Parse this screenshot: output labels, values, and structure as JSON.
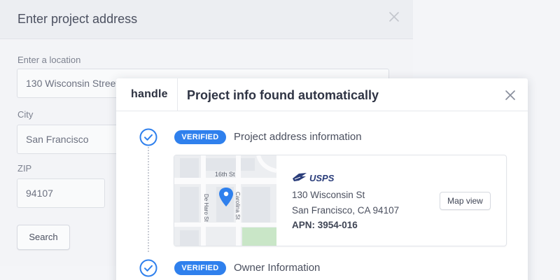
{
  "background_modal": {
    "title": "Enter project address",
    "location_label": "Enter a location",
    "location_value": "130 Wisconsin Street",
    "city_label": "City",
    "city_value": "San Francisco",
    "zip_label": "ZIP",
    "zip_value": "94107",
    "search_label": "Search"
  },
  "project_modal": {
    "logo": "handle",
    "title": "Project info found automatically",
    "steps": [
      {
        "badge": "VERIFIED",
        "title": "Project address information",
        "card": {
          "source": "USPS",
          "address_line1": "130 Wisconsin St",
          "address_line2": "San Francisco, CA 94107",
          "apn": "APN: 3954-016",
          "map_button": "Map view",
          "map_labels": {
            "street_1": "16th St",
            "street_2": "De Haro St",
            "street_3": "Carolina St"
          }
        }
      },
      {
        "badge": "VERIFIED",
        "title": "Owner Information"
      }
    ]
  },
  "colors": {
    "accent": "#2f80ed",
    "pin": "#2f80ed",
    "park": "#c9e6c7"
  },
  "icons": [
    "close-icon",
    "check-circle-icon",
    "map-pin-icon",
    "usps-eagle-icon"
  ]
}
